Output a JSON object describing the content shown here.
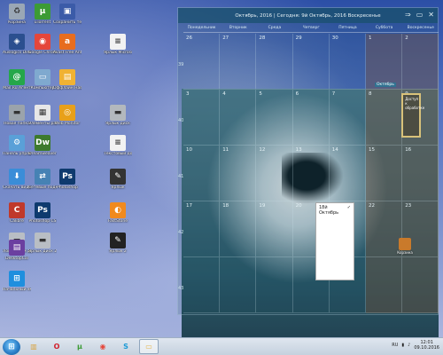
{
  "desktop_icons": [
    {
      "name": "Корзина",
      "icon": "recycle-bin-icon",
      "color": "#9aa7b5",
      "glyph": "♻"
    },
    {
      "name": "uTorrent",
      "icon": "utorrent-icon",
      "color": "#3c9b35",
      "glyph": "µ"
    },
    {
      "name": "Сохранить тексты",
      "icon": "floppy-icon",
      "color": "#3b5ba8",
      "glyph": "▣"
    },
    {
      "name": "Auslogics Disk Defrag",
      "icon": "auslogics-icon",
      "color": "#2b4f8f",
      "glyph": "◈"
    },
    {
      "name": "Google Chrome",
      "icon": "chrome-icon",
      "color": "#e5463a",
      "glyph": "◉"
    },
    {
      "name": "Avast Free Antivirus",
      "icon": "avast-icon",
      "color": "#e76d1e",
      "glyph": "a"
    },
    {
      "name": "Ярлык Microsoft Word",
      "icon": "word-doc-icon",
      "color": "#f2f2f2",
      "glyph": "≡"
    },
    {
      "name": "Mail.Ru Агент",
      "icon": "mail-agent-icon",
      "color": "#25a74a",
      "glyph": "@"
    },
    {
      "name": "Компьютер",
      "icon": "computer-icon",
      "color": "#7fa9cf",
      "glyph": "▭"
    },
    {
      "name": "Оффлайн Навигатор",
      "icon": "navigator-icon",
      "color": "#f0b233",
      "glyph": "▤"
    },
    {
      "name": "Новая папка",
      "icon": "drive-icon",
      "color": "#9ba3ab",
      "glyph": "▬"
    },
    {
      "name": "Элементы рабочего стола",
      "icon": "desktop-items-icon",
      "color": "#e7e7e7",
      "glyph": "▦"
    },
    {
      "name": "Web Monitor",
      "icon": "webmonitor-icon",
      "color": "#e8a01a",
      "glyph": "◎"
    },
    {
      "name": "Ярлык диск",
      "icon": "disk-shortcut-icon",
      "color": "#b3b8bd",
      "glyph": "▬"
    },
    {
      "name": "Панель управления",
      "icon": "control-panel-icon",
      "color": "#5aa0d8",
      "glyph": "⚙"
    },
    {
      "name": "Dreamweaver",
      "icon": "dreamweaver-icon",
      "color": "#3d7a2d",
      "glyph": "Dw"
    },
    {
      "name": "Текстовый документ",
      "icon": "text-doc-icon",
      "color": "#f2f2f2",
      "glyph": "≡"
    },
    {
      "name": "Скачать видео",
      "icon": "video-download-icon",
      "color": "#3a8dd8",
      "glyph": "⬇"
    },
    {
      "name": "Сетевые подключения",
      "icon": "network-icon",
      "color": "#4682b4",
      "glyph": "⇄"
    },
    {
      "name": "Photoshop",
      "icon": "photoshop-icon",
      "color": "#0e3a6e",
      "glyph": "Ps"
    },
    {
      "name": "Ярлык",
      "icon": "shortcut-icon",
      "color": "#333333",
      "glyph": "✎"
    },
    {
      "name": "Calibre",
      "icon": "calibre-icon",
      "color": "#c0392b",
      "glyph": "C"
    },
    {
      "name": "Photoshop CS",
      "icon": "photoshop2-icon",
      "color": "#0e3a6e",
      "glyph": "Ps"
    },
    {
      "name": "FastStone",
      "icon": "faststone-icon",
      "color": "#f08a1e",
      "glyph": "◐"
    },
    {
      "name": "Локальный диск",
      "icon": "local-disk-icon",
      "color": "#b9bec4",
      "glyph": "▬"
    },
    {
      "name": "Ярлык диск 2",
      "icon": "disk-shortcut2-icon",
      "color": "#b9bec4",
      "glyph": "▬"
    },
    {
      "name": "Ярлык 2",
      "icon": "shortcut2-icon",
      "color": "#222222",
      "glyph": "✎"
    },
    {
      "name": "DesktopCal",
      "icon": "desktopcal-icon",
      "color": "#6b3fa0",
      "glyph": "▤"
    },
    {
      "name": "Начальный экран",
      "icon": "metro-icon",
      "color": "#1f8fde",
      "glyph": "⊞"
    }
  ],
  "calendar": {
    "title": "Октябрь, 2016 | Сегодня: 9й Октябрь, 2016 Воскресенье",
    "day_names": [
      "Понедельник",
      "Вторник",
      "Среда",
      "Четверг",
      "Пятница",
      "Суббота",
      "Воскресенье"
    ],
    "week_numbers": [
      "39",
      "40",
      "41",
      "42",
      "43"
    ],
    "rows": [
      [
        "26",
        "27",
        "28",
        "29",
        "30",
        "1",
        "2"
      ],
      [
        "3",
        "4",
        "5",
        "6",
        "7",
        "8",
        "9"
      ],
      [
        "10",
        "11",
        "12",
        "13",
        "14",
        "15",
        "16"
      ],
      [
        "17",
        "18",
        "19",
        "20",
        "21",
        "22",
        "23"
      ],
      [
        "",
        "",
        "",
        "",
        "",
        "",
        ""
      ]
    ],
    "month_marker": "Октябрь",
    "event_text": "Доступ к обработке",
    "popup": {
      "title": "18й Октябрь",
      "check": "✓"
    },
    "mini_item_label": "Корзина",
    "nav": [
      "⇒",
      "▭",
      "✕"
    ]
  },
  "taskbar": {
    "apps": [
      {
        "name": "Explorer",
        "icon": "explorer-icon",
        "color": "#d9a441",
        "glyph": "▥"
      },
      {
        "name": "Opera",
        "icon": "opera-icon",
        "color": "#d11f2a",
        "glyph": "O"
      },
      {
        "name": "uTorrent",
        "icon": "utorrent-taskbar-icon",
        "color": "#3c9b35",
        "glyph": "µ"
      },
      {
        "name": "Chrome",
        "icon": "chrome-taskbar-icon",
        "color": "#e5463a",
        "glyph": "◉"
      },
      {
        "name": "Skype",
        "icon": "skype-icon",
        "color": "#1a9ad6",
        "glyph": "S"
      },
      {
        "name": "Folder",
        "icon": "folder-taskbar-icon",
        "color": "#e3b54c",
        "glyph": "▭"
      }
    ],
    "lang": "RU",
    "time": "12:01",
    "date": "09.10.2016"
  }
}
